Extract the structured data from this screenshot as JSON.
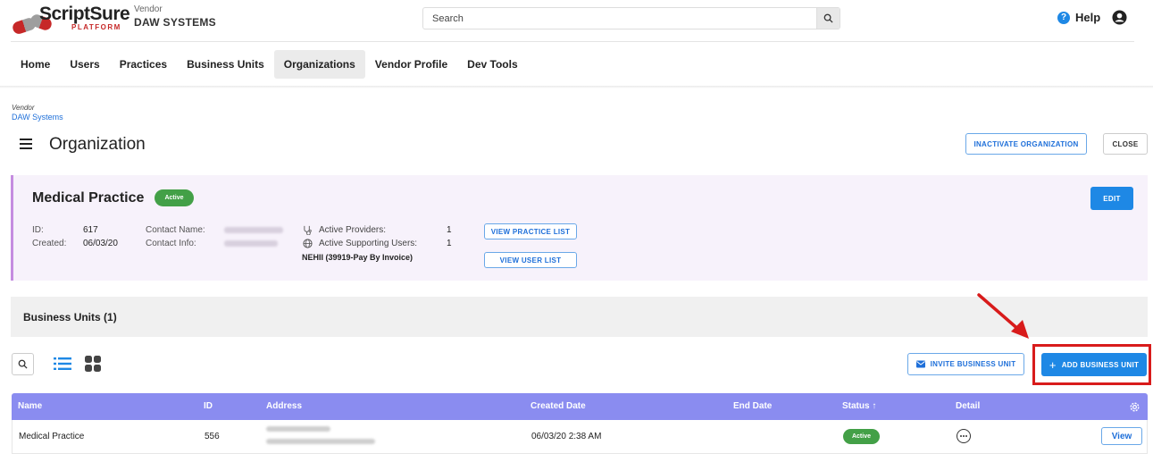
{
  "brand": {
    "name": "ScriptSure",
    "platform": "PLATFORM"
  },
  "vendor": {
    "label": "Vendor",
    "name": "DAW SYSTEMS"
  },
  "search": {
    "placeholder": "Search"
  },
  "help": {
    "label": "Help"
  },
  "nav": {
    "tabs": [
      {
        "label": "Home"
      },
      {
        "label": "Users"
      },
      {
        "label": "Practices"
      },
      {
        "label": "Business Units"
      },
      {
        "label": "Organizations",
        "active": true
      },
      {
        "label": "Vendor Profile"
      },
      {
        "label": "Dev Tools"
      }
    ]
  },
  "breadcrumb": {
    "label": "Vendor",
    "link": "DAW Systems"
  },
  "page": {
    "title": "Organization",
    "inactivate_label": "INACTIVATE ORGANIZATION",
    "close_label": "CLOSE"
  },
  "practice": {
    "name": "Medical Practice",
    "status": "Active",
    "edit_label": "EDIT",
    "id_label": "ID:",
    "id_value": "617",
    "created_label": "Created:",
    "created_value": "06/03/20",
    "contact_name_label": "Contact Name:",
    "contact_info_label": "Contact Info:",
    "active_providers_label": "Active Providers:",
    "active_providers_value": "1",
    "active_supporting_label": "Active Supporting Users:",
    "active_supporting_value": "1",
    "plan": "NEHII (39919-Pay By Invoice)",
    "view_practice_list": "VIEW PRACTICE LIST",
    "view_user_list": "VIEW USER LIST"
  },
  "business_units": {
    "title": "Business Units (1)",
    "invite_label": "INVITE BUSINESS UNIT",
    "add_label": "ADD BUSINESS UNIT",
    "add_icon": "+",
    "columns": {
      "name": "Name",
      "id": "ID",
      "address": "Address",
      "created": "Created Date",
      "end": "End Date",
      "status": "Status ↑",
      "detail": "Detail"
    },
    "rows": [
      {
        "name": "Medical Practice",
        "id": "556",
        "created": "06/03/20 2:38 AM",
        "end": "",
        "status": "Active",
        "action": "View"
      }
    ]
  },
  "colors": {
    "accent": "#1e88e5",
    "table_header": "#8a8cf0",
    "active_badge": "#43a047",
    "card_bg": "#f7f2fb",
    "card_border": "#c58de0",
    "callout": "#d81b1b"
  },
  "icons": [
    "search-icon",
    "help-icon",
    "user-account-icon",
    "hamburger-icon",
    "stethoscope-icon",
    "globe-icon",
    "list-view-icon",
    "grid-view-icon",
    "envelope-icon",
    "gear-icon",
    "more-options-icon",
    "red-arrow-annotation"
  ]
}
